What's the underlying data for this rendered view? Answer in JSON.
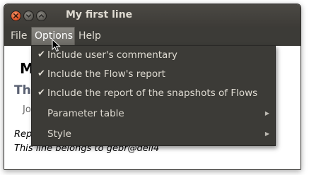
{
  "window": {
    "title": "My first line"
  },
  "menubar": {
    "items": [
      {
        "label": "File"
      },
      {
        "label": "Options"
      },
      {
        "label": "Help"
      }
    ]
  },
  "content": {
    "heading_1": "M",
    "heading_2": "Th",
    "meta": "Jo",
    "line_1": "Rep",
    "line_2": "This line belongs to gebr@dell4"
  },
  "options_menu": {
    "items": [
      {
        "label": "Include user's commentary",
        "checked": true
      },
      {
        "label": "Include the Flow's report",
        "checked": true
      },
      {
        "label": "Include the report of the snapshots of Flows",
        "checked": true
      },
      {
        "label": "Parameter table",
        "submenu": true
      },
      {
        "label": "Style",
        "submenu": true
      }
    ]
  },
  "icons": {
    "check": "checkmark-icon",
    "submenu": "submenu-arrow-icon",
    "close": "close-icon",
    "minimize": "minimize-icon",
    "maximize": "maximize-icon"
  },
  "colors": {
    "titlebar": "#3d3b37",
    "menu_bg": "#3c3b37",
    "menu_text": "#dfdbd2",
    "close_button": "#e0572a",
    "active_menu": "#7a7873"
  }
}
